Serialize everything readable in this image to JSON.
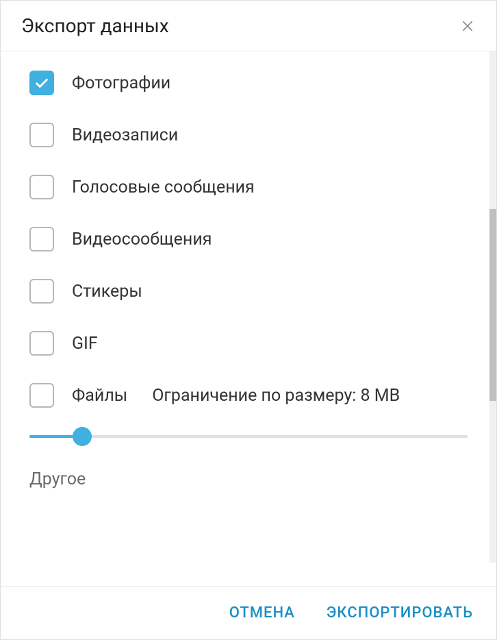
{
  "dialog": {
    "title": "Экспорт данных"
  },
  "options": {
    "photos": {
      "label": "Фотографии",
      "checked": true
    },
    "videos": {
      "label": "Видеозаписи",
      "checked": false
    },
    "voice_messages": {
      "label": "Голосовые сообщения",
      "checked": false
    },
    "video_messages": {
      "label": "Видеосообщения",
      "checked": false
    },
    "stickers": {
      "label": "Стикеры",
      "checked": false
    },
    "gif": {
      "label": "GIF",
      "checked": false
    },
    "files": {
      "label": "Файлы",
      "checked": false,
      "size_limit_label": "Ограничение по размеру: 8 MB"
    }
  },
  "slider": {
    "value_percent": 12
  },
  "sections": {
    "other": "Другое"
  },
  "footer": {
    "cancel": "ОТМЕНА",
    "export": "ЭКСПОРТИРОВАТЬ"
  }
}
